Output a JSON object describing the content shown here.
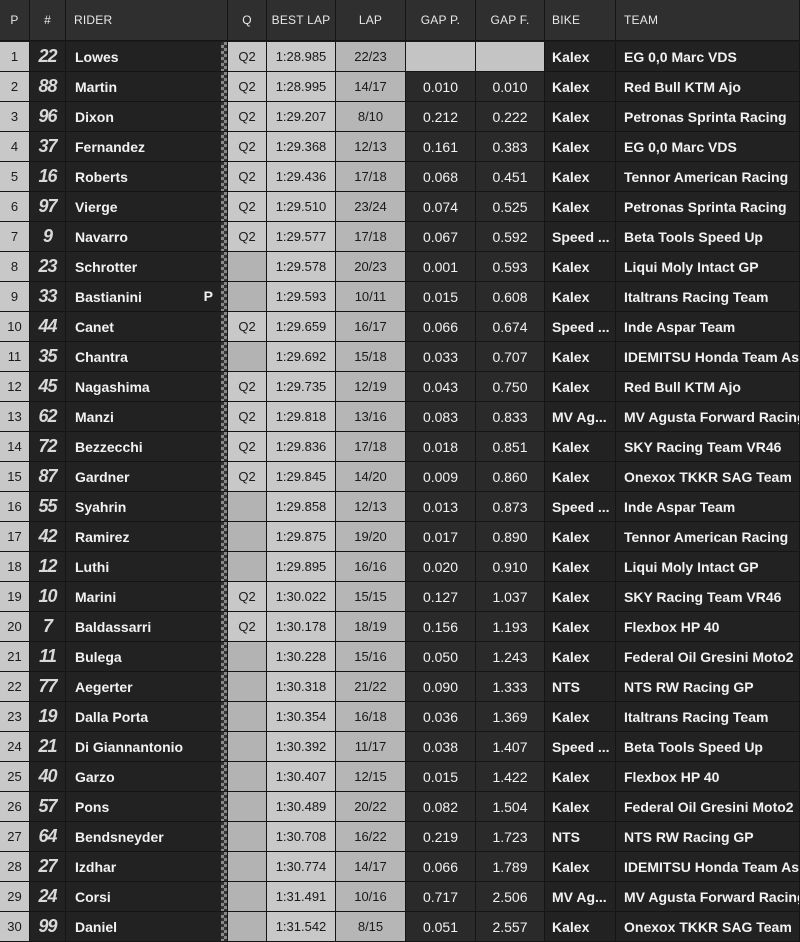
{
  "headers": {
    "p": "P",
    "num": "#",
    "rider": "RIDER",
    "q": "Q",
    "best": "BEST LAP",
    "lap": "LAP",
    "gap_p": "GAP P.",
    "gap_f": "GAP F.",
    "bike": "BIKE",
    "team": "TEAM"
  },
  "rows": [
    {
      "p": "1",
      "num": "22",
      "rider": "Lowes",
      "pit": "",
      "q": "Q2",
      "best": "1:28.985",
      "lap": "22/23",
      "gp": "",
      "gf": "",
      "bike": "Kalex",
      "team": "EG 0,0 Marc VDS"
    },
    {
      "p": "2",
      "num": "88",
      "rider": "Martin",
      "pit": "",
      "q": "Q2",
      "best": "1:28.995",
      "lap": "14/17",
      "gp": "0.010",
      "gf": "0.010",
      "bike": "Kalex",
      "team": "Red Bull KTM Ajo"
    },
    {
      "p": "3",
      "num": "96",
      "rider": "Dixon",
      "pit": "",
      "q": "Q2",
      "best": "1:29.207",
      "lap": "8/10",
      "gp": "0.212",
      "gf": "0.222",
      "bike": "Kalex",
      "team": "Petronas Sprinta Racing"
    },
    {
      "p": "4",
      "num": "37",
      "rider": "Fernandez",
      "pit": "",
      "q": "Q2",
      "best": "1:29.368",
      "lap": "12/13",
      "gp": "0.161",
      "gf": "0.383",
      "bike": "Kalex",
      "team": "EG 0,0 Marc VDS"
    },
    {
      "p": "5",
      "num": "16",
      "rider": "Roberts",
      "pit": "",
      "q": "Q2",
      "best": "1:29.436",
      "lap": "17/18",
      "gp": "0.068",
      "gf": "0.451",
      "bike": "Kalex",
      "team": "Tennor American Racing"
    },
    {
      "p": "6",
      "num": "97",
      "rider": "Vierge",
      "pit": "",
      "q": "Q2",
      "best": "1:29.510",
      "lap": "23/24",
      "gp": "0.074",
      "gf": "0.525",
      "bike": "Kalex",
      "team": "Petronas Sprinta Racing"
    },
    {
      "p": "7",
      "num": "9",
      "rider": "Navarro",
      "pit": "",
      "q": "Q2",
      "best": "1:29.577",
      "lap": "17/18",
      "gp": "0.067",
      "gf": "0.592",
      "bike": "Speed ...",
      "team": "Beta Tools Speed Up"
    },
    {
      "p": "8",
      "num": "23",
      "rider": "Schrotter",
      "pit": "",
      "q": "",
      "best": "1:29.578",
      "lap": "20/23",
      "gp": "0.001",
      "gf": "0.593",
      "bike": "Kalex",
      "team": "Liqui Moly Intact GP"
    },
    {
      "p": "9",
      "num": "33",
      "rider": "Bastianini",
      "pit": "P",
      "q": "",
      "best": "1:29.593",
      "lap": "10/11",
      "gp": "0.015",
      "gf": "0.608",
      "bike": "Kalex",
      "team": "Italtrans Racing Team"
    },
    {
      "p": "10",
      "num": "44",
      "rider": "Canet",
      "pit": "",
      "q": "Q2",
      "best": "1:29.659",
      "lap": "16/17",
      "gp": "0.066",
      "gf": "0.674",
      "bike": "Speed ...",
      "team": "Inde Aspar Team"
    },
    {
      "p": "11",
      "num": "35",
      "rider": "Chantra",
      "pit": "",
      "q": "",
      "best": "1:29.692",
      "lap": "15/18",
      "gp": "0.033",
      "gf": "0.707",
      "bike": "Kalex",
      "team": "IDEMITSU Honda Team Asia"
    },
    {
      "p": "12",
      "num": "45",
      "rider": "Nagashima",
      "pit": "",
      "q": "Q2",
      "best": "1:29.735",
      "lap": "12/19",
      "gp": "0.043",
      "gf": "0.750",
      "bike": "Kalex",
      "team": "Red Bull KTM Ajo"
    },
    {
      "p": "13",
      "num": "62",
      "rider": "Manzi",
      "pit": "",
      "q": "Q2",
      "best": "1:29.818",
      "lap": "13/16",
      "gp": "0.083",
      "gf": "0.833",
      "bike": "MV Ag...",
      "team": "MV Agusta Forward Racing"
    },
    {
      "p": "14",
      "num": "72",
      "rider": "Bezzecchi",
      "pit": "",
      "q": "Q2",
      "best": "1:29.836",
      "lap": "17/18",
      "gp": "0.018",
      "gf": "0.851",
      "bike": "Kalex",
      "team": "SKY Racing Team VR46"
    },
    {
      "p": "15",
      "num": "87",
      "rider": "Gardner",
      "pit": "",
      "q": "Q2",
      "best": "1:29.845",
      "lap": "14/20",
      "gp": "0.009",
      "gf": "0.860",
      "bike": "Kalex",
      "team": "Onexox TKKR SAG Team"
    },
    {
      "p": "16",
      "num": "55",
      "rider": "Syahrin",
      "pit": "",
      "q": "",
      "best": "1:29.858",
      "lap": "12/13",
      "gp": "0.013",
      "gf": "0.873",
      "bike": "Speed ...",
      "team": "Inde Aspar Team"
    },
    {
      "p": "17",
      "num": "42",
      "rider": "Ramirez",
      "pit": "",
      "q": "",
      "best": "1:29.875",
      "lap": "19/20",
      "gp": "0.017",
      "gf": "0.890",
      "bike": "Kalex",
      "team": "Tennor American Racing"
    },
    {
      "p": "18",
      "num": "12",
      "rider": "Luthi",
      "pit": "",
      "q": "",
      "best": "1:29.895",
      "lap": "16/16",
      "gp": "0.020",
      "gf": "0.910",
      "bike": "Kalex",
      "team": "Liqui Moly Intact GP"
    },
    {
      "p": "19",
      "num": "10",
      "rider": "Marini",
      "pit": "",
      "q": "Q2",
      "best": "1:30.022",
      "lap": "15/15",
      "gp": "0.127",
      "gf": "1.037",
      "bike": "Kalex",
      "team": "SKY Racing Team VR46"
    },
    {
      "p": "20",
      "num": "7",
      "rider": "Baldassarri",
      "pit": "",
      "q": "Q2",
      "best": "1:30.178",
      "lap": "18/19",
      "gp": "0.156",
      "gf": "1.193",
      "bike": "Kalex",
      "team": "Flexbox HP 40"
    },
    {
      "p": "21",
      "num": "11",
      "rider": "Bulega",
      "pit": "",
      "q": "",
      "best": "1:30.228",
      "lap": "15/16",
      "gp": "0.050",
      "gf": "1.243",
      "bike": "Kalex",
      "team": "Federal Oil Gresini Moto2"
    },
    {
      "p": "22",
      "num": "77",
      "rider": "Aegerter",
      "pit": "",
      "q": "",
      "best": "1:30.318",
      "lap": "21/22",
      "gp": "0.090",
      "gf": "1.333",
      "bike": "NTS",
      "team": "NTS RW Racing GP"
    },
    {
      "p": "23",
      "num": "19",
      "rider": "Dalla Porta",
      "pit": "",
      "q": "",
      "best": "1:30.354",
      "lap": "16/18",
      "gp": "0.036",
      "gf": "1.369",
      "bike": "Kalex",
      "team": "Italtrans Racing Team"
    },
    {
      "p": "24",
      "num": "21",
      "rider": "Di Giannantonio",
      "pit": "",
      "q": "",
      "best": "1:30.392",
      "lap": "11/17",
      "gp": "0.038",
      "gf": "1.407",
      "bike": "Speed ...",
      "team": "Beta Tools Speed Up"
    },
    {
      "p": "25",
      "num": "40",
      "rider": "Garzo",
      "pit": "",
      "q": "",
      "best": "1:30.407",
      "lap": "12/15",
      "gp": "0.015",
      "gf": "1.422",
      "bike": "Kalex",
      "team": "Flexbox HP 40"
    },
    {
      "p": "26",
      "num": "57",
      "rider": "Pons",
      "pit": "",
      "q": "",
      "best": "1:30.489",
      "lap": "20/22",
      "gp": "0.082",
      "gf": "1.504",
      "bike": "Kalex",
      "team": "Federal Oil Gresini Moto2"
    },
    {
      "p": "27",
      "num": "64",
      "rider": "Bendsneyder",
      "pit": "",
      "q": "",
      "best": "1:30.708",
      "lap": "16/22",
      "gp": "0.219",
      "gf": "1.723",
      "bike": "NTS",
      "team": "NTS RW Racing GP"
    },
    {
      "p": "28",
      "num": "27",
      "rider": "Izdhar",
      "pit": "",
      "q": "",
      "best": "1:30.774",
      "lap": "14/17",
      "gp": "0.066",
      "gf": "1.789",
      "bike": "Kalex",
      "team": "IDEMITSU Honda Team Asia"
    },
    {
      "p": "29",
      "num": "24",
      "rider": "Corsi",
      "pit": "",
      "q": "",
      "best": "1:31.491",
      "lap": "10/16",
      "gp": "0.717",
      "gf": "2.506",
      "bike": "MV Ag...",
      "team": "MV Agusta Forward Racing"
    },
    {
      "p": "30",
      "num": "99",
      "rider": "Daniel",
      "pit": "",
      "q": "",
      "best": "1:31.542",
      "lap": "8/15",
      "gp": "0.051",
      "gf": "2.557",
      "bike": "Kalex",
      "team": "Onexox TKKR SAG Team"
    }
  ]
}
